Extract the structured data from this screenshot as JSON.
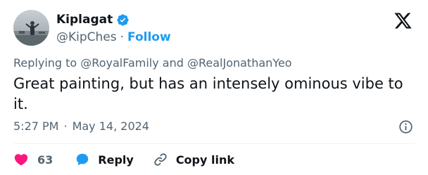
{
  "author": {
    "display_name": "Kiplagat",
    "handle": "@KipChes",
    "separator": "·",
    "follow_label": "Follow",
    "verified": true,
    "verified_color": "#1d9bf0"
  },
  "reply_context": {
    "prefix": "Replying to",
    "mention_1": "@RoyalFamily",
    "conjunction": "and",
    "mention_2": "@RealJonathanYeo"
  },
  "tweet": {
    "text": "Great painting, but has an intensely ominous vibe to it.",
    "time": "5:27 PM",
    "separator": "·",
    "date": "May 14, 2024"
  },
  "actions": {
    "like_count": "63",
    "reply_label": "Reply",
    "copy_link_label": "Copy link"
  },
  "colors": {
    "accent": "#1d9bf0",
    "like": "#f91880",
    "text_primary": "#0f1419",
    "text_secondary": "#536471"
  },
  "icons": {
    "verified": "verified-badge-icon",
    "logo": "x-logo-icon",
    "info": "info-icon",
    "like": "heart-icon",
    "reply": "speech-bubble-icon",
    "copy": "link-icon"
  }
}
